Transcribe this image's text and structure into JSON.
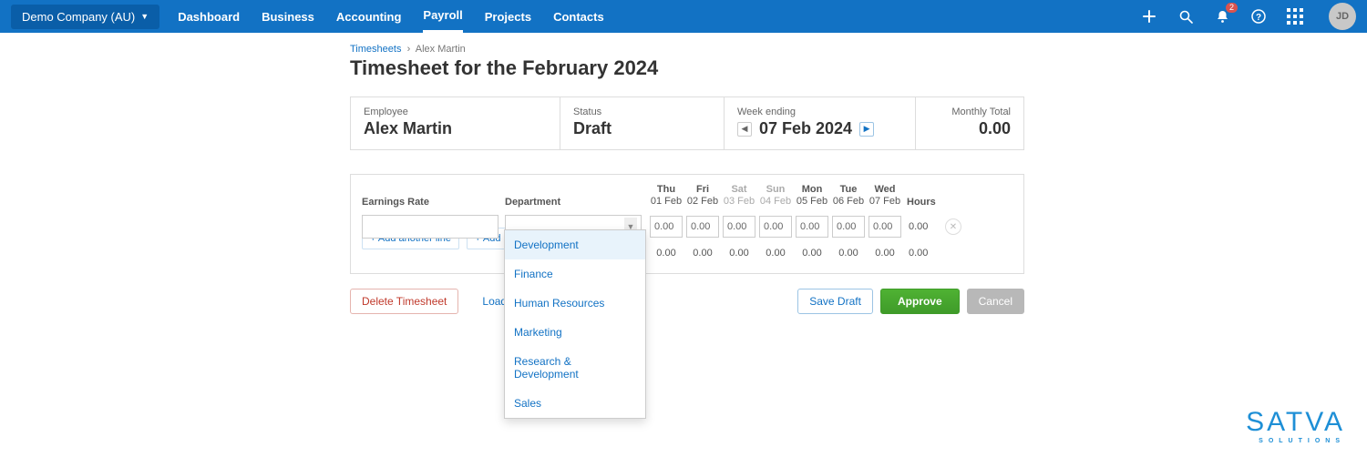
{
  "topbar": {
    "company": "Demo Company (AU)",
    "nav": [
      "Dashboard",
      "Business",
      "Accounting",
      "Payroll",
      "Projects",
      "Contacts"
    ],
    "active_index": 3,
    "notification_count": "2",
    "avatar_initials": "JD"
  },
  "breadcrumb": {
    "root": "Timesheets",
    "sep": "›",
    "leaf": "Alex Martin"
  },
  "title": "Timesheet for the February 2024",
  "summary": {
    "employee_label": "Employee",
    "employee_value": "Alex Martin",
    "status_label": "Status",
    "status_value": "Draft",
    "week_label": "Week ending",
    "week_value": "07 Feb 2024",
    "total_label": "Monthly Total",
    "total_value": "0.00"
  },
  "grid": {
    "headers": {
      "rate": "Earnings Rate",
      "dept": "Department",
      "hours": "Hours"
    },
    "days": [
      {
        "dow": "Thu",
        "date": "01 Feb",
        "weekend": false
      },
      {
        "dow": "Fri",
        "date": "02 Feb",
        "weekend": false
      },
      {
        "dow": "Sat",
        "date": "03 Feb",
        "weekend": true
      },
      {
        "dow": "Sun",
        "date": "04 Feb",
        "weekend": true
      },
      {
        "dow": "Mon",
        "date": "05 Feb",
        "weekend": false
      },
      {
        "dow": "Tue",
        "date": "06 Feb",
        "weekend": false
      },
      {
        "dow": "Wed",
        "date": "07 Feb",
        "weekend": false
      }
    ],
    "row": {
      "values": [
        "0.00",
        "0.00",
        "0.00",
        "0.00",
        "0.00",
        "0.00",
        "0.00"
      ],
      "hours": "0.00"
    },
    "totals": [
      "0.00",
      "0.00",
      "0.00",
      "0.00",
      "0.00",
      "0.00",
      "0.00"
    ],
    "totals_hours": "0.00",
    "add_line": "+ Add another line",
    "add_project": "+ Add Project line"
  },
  "dropdown": {
    "items": [
      "Development",
      "Finance",
      "Human Resources",
      "Marketing",
      "Research & Development",
      "Sales"
    ],
    "highlighted": 0
  },
  "actions": {
    "delete": "Delete Timesheet",
    "load": "Load Template",
    "save": "Save Draft",
    "approve": "Approve",
    "cancel": "Cancel"
  },
  "brand": {
    "name": "SATVA",
    "tag": "SOLUTIONS"
  }
}
